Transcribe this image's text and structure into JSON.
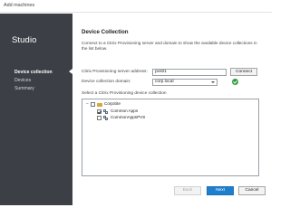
{
  "window": {
    "title": "Add machines"
  },
  "sidebar": {
    "app_name": "Studio",
    "steps": [
      {
        "label": "Device collection",
        "active": true
      },
      {
        "label": "Devices",
        "active": false
      },
      {
        "label": "Summary",
        "active": false
      }
    ]
  },
  "main": {
    "heading": "Device Collection",
    "description": "Connect to a Citrix Provisioning server and domain to show the available device collections in the list below.",
    "server_label": "Citrix Provisioning server address:",
    "server_value": "pvs01",
    "connect_label": "Connect",
    "domain_label": "Device collection domain:",
    "domain_value": "corp.local",
    "tree_label": "Select a Citrix Provisioning device collection",
    "tree": {
      "root": {
        "label": "CorpSite",
        "expander": "−"
      },
      "children": [
        {
          "label": "Common Apps",
          "checked": true
        },
        {
          "label": "CommonAppsPVS",
          "checked": false
        }
      ]
    }
  },
  "footer": {
    "back_label": "Back",
    "next_label": "Next",
    "cancel_label": "Cancel"
  },
  "colors": {
    "sidebar_bg": "#3c4046",
    "primary_button": "#1f7fcf",
    "status_ok": "#2e9e3a"
  },
  "icons": [
    "checkmark-circle-icon",
    "folder-icon",
    "device-collection-icon",
    "chevron-down-icon",
    "collapse-icon"
  ]
}
